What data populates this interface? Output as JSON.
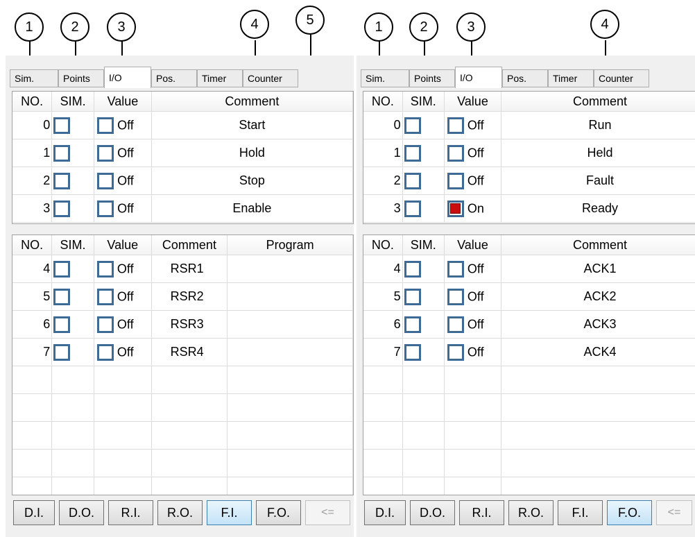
{
  "callouts": {
    "left": [
      "1",
      "2",
      "3",
      "4",
      "5"
    ],
    "right": [
      "1",
      "2",
      "3",
      "4"
    ]
  },
  "tabs": [
    "Sim.",
    "Points",
    "I/O",
    "Pos.",
    "Timer",
    "Counter"
  ],
  "active_tab": "I/O",
  "left_panel": {
    "upper_headers": [
      "NO.",
      "SIM.",
      "Value",
      "Comment"
    ],
    "upper_rows": [
      {
        "no": "0",
        "sim": false,
        "value_on": false,
        "value": "Off",
        "comment": "Start"
      },
      {
        "no": "1",
        "sim": false,
        "value_on": false,
        "value": "Off",
        "comment": "Hold"
      },
      {
        "no": "2",
        "sim": false,
        "value_on": false,
        "value": "Off",
        "comment": "Stop"
      },
      {
        "no": "3",
        "sim": false,
        "value_on": false,
        "value": "Off",
        "comment": "Enable"
      }
    ],
    "lower_headers": [
      "NO.",
      "SIM.",
      "Value",
      "Comment",
      "Program"
    ],
    "lower_rows": [
      {
        "no": "4",
        "sim": false,
        "value_on": false,
        "value": "Off",
        "comment": "RSR1",
        "program": ""
      },
      {
        "no": "5",
        "sim": false,
        "value_on": false,
        "value": "Off",
        "comment": "RSR2",
        "program": ""
      },
      {
        "no": "6",
        "sim": false,
        "value_on": false,
        "value": "Off",
        "comment": "RSR3",
        "program": ""
      },
      {
        "no": "7",
        "sim": false,
        "value_on": false,
        "value": "Off",
        "comment": "RSR4",
        "program": ""
      }
    ],
    "selected_button": "F.I."
  },
  "right_panel": {
    "upper_headers": [
      "NO.",
      "SIM.",
      "Value",
      "Comment"
    ],
    "upper_rows": [
      {
        "no": "0",
        "sim": false,
        "value_on": false,
        "value": "Off",
        "comment": "Run"
      },
      {
        "no": "1",
        "sim": false,
        "value_on": false,
        "value": "Off",
        "comment": "Held"
      },
      {
        "no": "2",
        "sim": false,
        "value_on": false,
        "value": "Off",
        "comment": "Fault"
      },
      {
        "no": "3",
        "sim": false,
        "value_on": true,
        "value": "On",
        "comment": "Ready"
      }
    ],
    "lower_headers": [
      "NO.",
      "SIM.",
      "Value",
      "Comment"
    ],
    "lower_rows": [
      {
        "no": "4",
        "sim": false,
        "value_on": false,
        "value": "Off",
        "comment": "ACK1"
      },
      {
        "no": "5",
        "sim": false,
        "value_on": false,
        "value": "Off",
        "comment": "ACK2"
      },
      {
        "no": "6",
        "sim": false,
        "value_on": false,
        "value": "Off",
        "comment": "ACK3"
      },
      {
        "no": "7",
        "sim": false,
        "value_on": false,
        "value": "Off",
        "comment": "ACK4"
      }
    ],
    "selected_button": "F.O."
  },
  "io_buttons": [
    "D.I.",
    "D.O.",
    "R.I.",
    "R.O.",
    "F.I.",
    "F.O.",
    "<="
  ],
  "colors": {
    "checkbox_border": "#3e6a96",
    "on_fill": "#cc0d0d",
    "selected_button": "#c4e3f8"
  }
}
